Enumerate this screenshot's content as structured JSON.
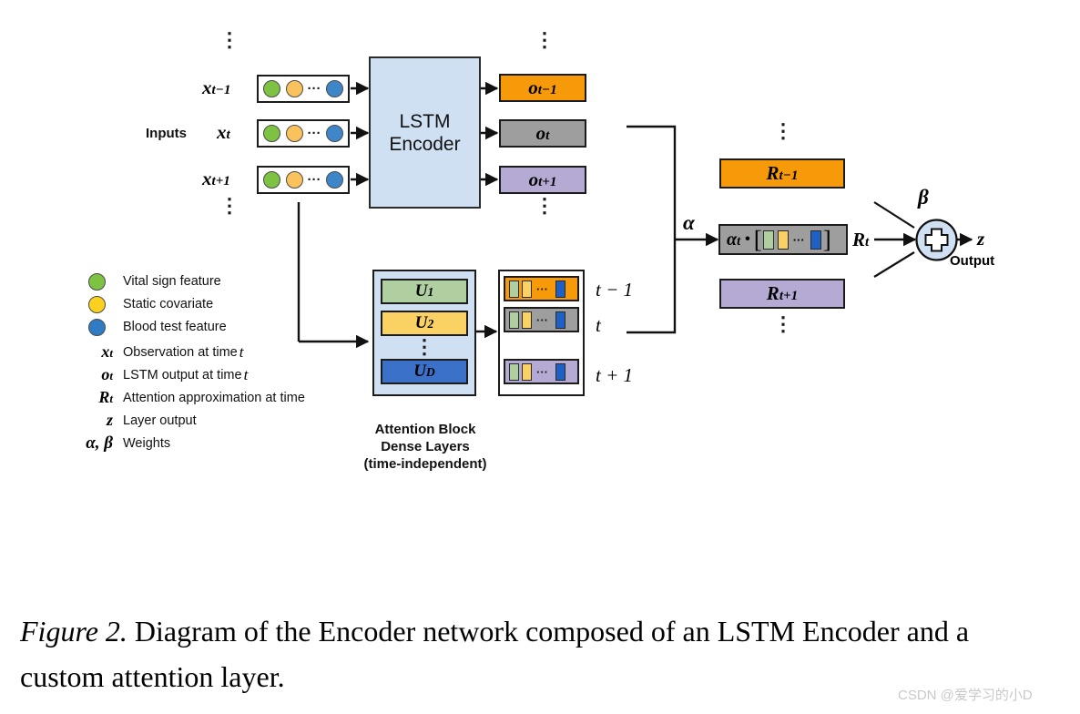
{
  "figure": {
    "caption_label": "Figure 2.",
    "caption_text": " Diagram of the Encoder network composed of an LSTM Encoder and a custom attention layer.",
    "watermark": "CSDN @爱学习的小D"
  },
  "colors": {
    "lstm_fill": "#cfe0f3",
    "orange": "#f79a0a",
    "gray": "#9e9e9e",
    "purple": "#b5aad4",
    "green": "#7dc242",
    "yellow": "#fbd01f",
    "blue": "#2f7bc4",
    "chip_green": "#b0cfa0",
    "chip_yellow": "#fad163",
    "chip_blue": "#1f60c4",
    "u1": "#b0cfa0",
    "u2": "#fad163",
    "ud": "#3b71c8",
    "border": "#1b1b1b"
  },
  "inputs": {
    "group_label": "Inputs",
    "rows": [
      {
        "label_base": "x",
        "label_sub": "t−1"
      },
      {
        "label_base": "x",
        "label_sub": "t"
      },
      {
        "label_base": "x",
        "label_sub": "t+1"
      }
    ],
    "top_ellipsis": "⋮",
    "bottom_ellipsis": "⋮",
    "vector_dots": "···"
  },
  "encoder": {
    "line1": "LSTM",
    "line2": "Encoder"
  },
  "outputs": {
    "top_ellipsis": "⋮",
    "bottom_ellipsis": "⋮",
    "rows": [
      {
        "base": "o",
        "sub": "t−1",
        "color": "#f79a0a"
      },
      {
        "base": "o",
        "sub": "t",
        "color": "#9e9e9e"
      },
      {
        "base": "o",
        "sub": "t+1",
        "color": "#b5aad4"
      }
    ]
  },
  "attention_block": {
    "layers": [
      {
        "base": "U",
        "sub": "1",
        "color": "#b0cfa0"
      },
      {
        "base": "U",
        "sub": "2",
        "color": "#fad163"
      },
      {
        "base": "U",
        "sub": "D",
        "color": "#3b71c8"
      }
    ],
    "mid_ellipsis": "⋮",
    "caption_line1": "Attention Block",
    "caption_line2": "Dense Layers",
    "caption_line3": "(time-independent)"
  },
  "time_vectors": {
    "rows": [
      {
        "label": "t − 1",
        "color": "#f79a0a"
      },
      {
        "label": "t",
        "color": "#9e9e9e"
      },
      {
        "label": "t + 1",
        "color": "#b5aad4"
      }
    ],
    "dots": "···"
  },
  "attention_out": {
    "alpha_label": "α",
    "top_ellipsis": "⋮",
    "bottom_ellipsis": "⋮",
    "rows": [
      {
        "base": "R",
        "sub": "t−1",
        "color": "#f79a0a"
      },
      {
        "base": "R",
        "sub": "t",
        "color": "#9e9e9e"
      },
      {
        "base": "R",
        "sub": "t+1",
        "color": "#b5aad4"
      }
    ],
    "rt_inner_alpha": "α",
    "rt_inner_alpha_sub": "t",
    "rt_dot": "•",
    "rt_dots": "···",
    "rt_side_label_base": "R",
    "rt_side_label_sub": "t"
  },
  "sum_node": {
    "beta_label": "β",
    "plus": "+",
    "output_symbol": "z",
    "output_label": "Output"
  },
  "legend": {
    "items": [
      {
        "type": "circle",
        "color": "#7dc242",
        "text": "Vital sign feature"
      },
      {
        "type": "circle",
        "color": "#fbd01f",
        "text": "Static covariate"
      },
      {
        "type": "circle",
        "color": "#2f7bc4",
        "text": "Blood test feature"
      },
      {
        "type": "symbol",
        "sym_base": "x",
        "sym_sub": "t",
        "text": "Observation  at time ",
        "tail": "t"
      },
      {
        "type": "symbol",
        "sym_base": "o",
        "sym_sub": "t",
        "text": "LSTM output at time ",
        "tail": "t"
      },
      {
        "type": "symbol",
        "sym_base": "R",
        "sym_sub": "t",
        "text": "Attention approximation  at time",
        "tail": ""
      },
      {
        "type": "symbol",
        "sym_base": "z",
        "sym_sub": "",
        "text": "Layer output",
        "tail": ""
      },
      {
        "type": "symbol",
        "sym_base": "α, β",
        "sym_sub": "",
        "text": "Weights",
        "tail": ""
      }
    ]
  }
}
